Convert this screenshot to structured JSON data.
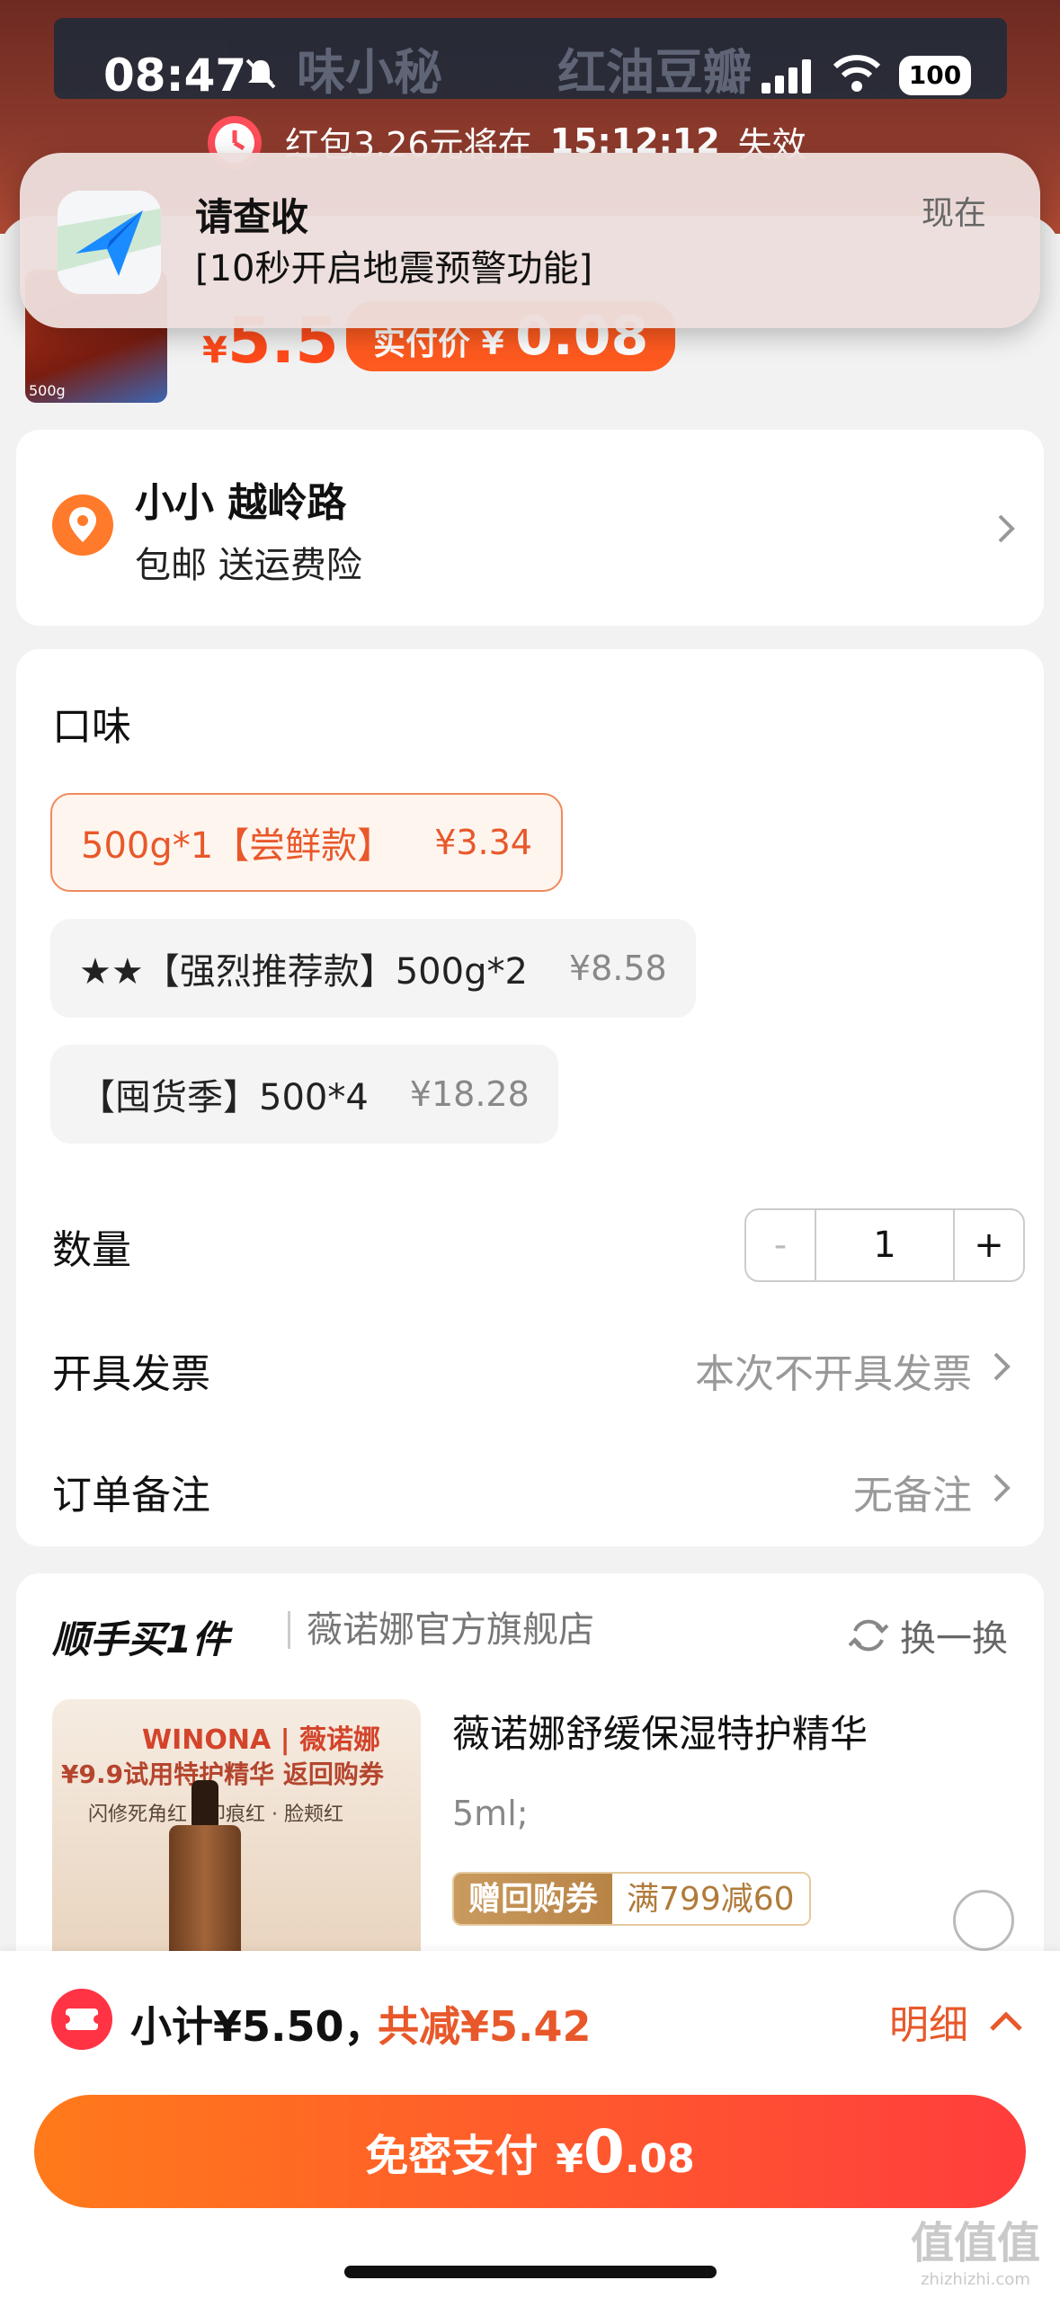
{
  "status_bar": {
    "time": "08:47",
    "battery": "100"
  },
  "background_store": {
    "left": "味小秘",
    "right": "红油豆瓣"
  },
  "timer_banner": {
    "prefix": "红包3.26元将在",
    "time": "15:12:12",
    "suffix": "失效"
  },
  "notification": {
    "title": "请查收",
    "body": "[10秒开启地震预警功能]",
    "time": "现在"
  },
  "product": {
    "thumb_label": "500g",
    "price_symbol": "¥",
    "price": "5.5",
    "real_price_label": "实付价",
    "real_price_symbol": "¥",
    "real_price": "0.08"
  },
  "address": {
    "name": "小小 越岭路",
    "shipping": "包邮 送运费险"
  },
  "options": {
    "title": "口味",
    "items": [
      {
        "label": "500g*1【尝鲜款】",
        "price": "¥3.34",
        "selected": true
      },
      {
        "label": "★★【强烈推荐款】500g*2",
        "price": "¥8.58",
        "selected": false
      },
      {
        "label": "【囤货季】500*4",
        "price": "¥18.28",
        "selected": false
      }
    ]
  },
  "quantity": {
    "label": "数量",
    "minus": "-",
    "value": "1",
    "plus": "+"
  },
  "invoice": {
    "label": "开具发票",
    "value": "本次不开具发票"
  },
  "remark": {
    "label": "订单备注",
    "value": "无备注"
  },
  "recommend": {
    "title": "顺手买1件",
    "store": "薇诺娜官方旗舰店",
    "refresh": "换一换",
    "image": {
      "brand": "WINONA | 薇诺娜",
      "promo": "¥9.9试用特护精华 返回购券",
      "tags": "闪修死角红 · 印痕红 · 脸颊红"
    },
    "name": "薇诺娜舒缓保湿特护精华",
    "spec": "5ml;",
    "coupon_tag": "赠回购券",
    "coupon_value": "满799减60"
  },
  "bottom": {
    "subtotal": "小计¥5.50，",
    "discount": "共减¥5.42",
    "detail": "明细",
    "pay_label": "免密支付",
    "pay_symbol": "¥",
    "pay_int": "0",
    "pay_dec": ".08"
  },
  "watermark": {
    "text": "值值值",
    "sub": "zhizhizhi.com"
  },
  "colors": {
    "accent": "#ff5a1f",
    "discount": "#e8582a",
    "pay_start": "#ff7a1a",
    "pay_end": "#ff3d3d"
  }
}
